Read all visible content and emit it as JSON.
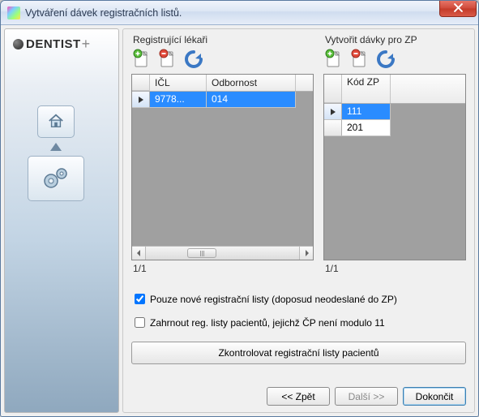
{
  "window": {
    "title": "Vytváření dávek registračních listů."
  },
  "sidebar": {
    "brand": "DENTIST",
    "brand_suffix": "+"
  },
  "panels": {
    "left": {
      "heading": "Registrující lékaři",
      "columns": {
        "c1": "IČL",
        "c2": "Odbornost"
      },
      "rows": [
        {
          "icl": "9778...",
          "odbornost": "014",
          "selected": true
        }
      ],
      "pager": "1/1"
    },
    "right": {
      "heading": "Vytvořit dávky pro ZP",
      "columns": {
        "c1": "Kód ZP"
      },
      "rows": [
        {
          "kod": "111",
          "selected": true
        },
        {
          "kod": "201",
          "selected": false
        }
      ],
      "pager": "1/1"
    }
  },
  "options": {
    "only_new": {
      "label": "Pouze nové registrační listy (doposud neodeslané do ZP)",
      "checked": true
    },
    "include_mod11": {
      "label": "Zahrnout reg. listy pacientů, jejichž ČP není modulo 11",
      "checked": false
    }
  },
  "actions": {
    "check_patients": "Zkontrolovat registrační listy pacientů"
  },
  "footer": {
    "back": "<< Zpět",
    "next": "Další >>",
    "finish": "Dokončit"
  },
  "icons": {
    "add": "add-page-icon",
    "remove": "remove-page-icon",
    "refresh": "refresh-icon"
  }
}
